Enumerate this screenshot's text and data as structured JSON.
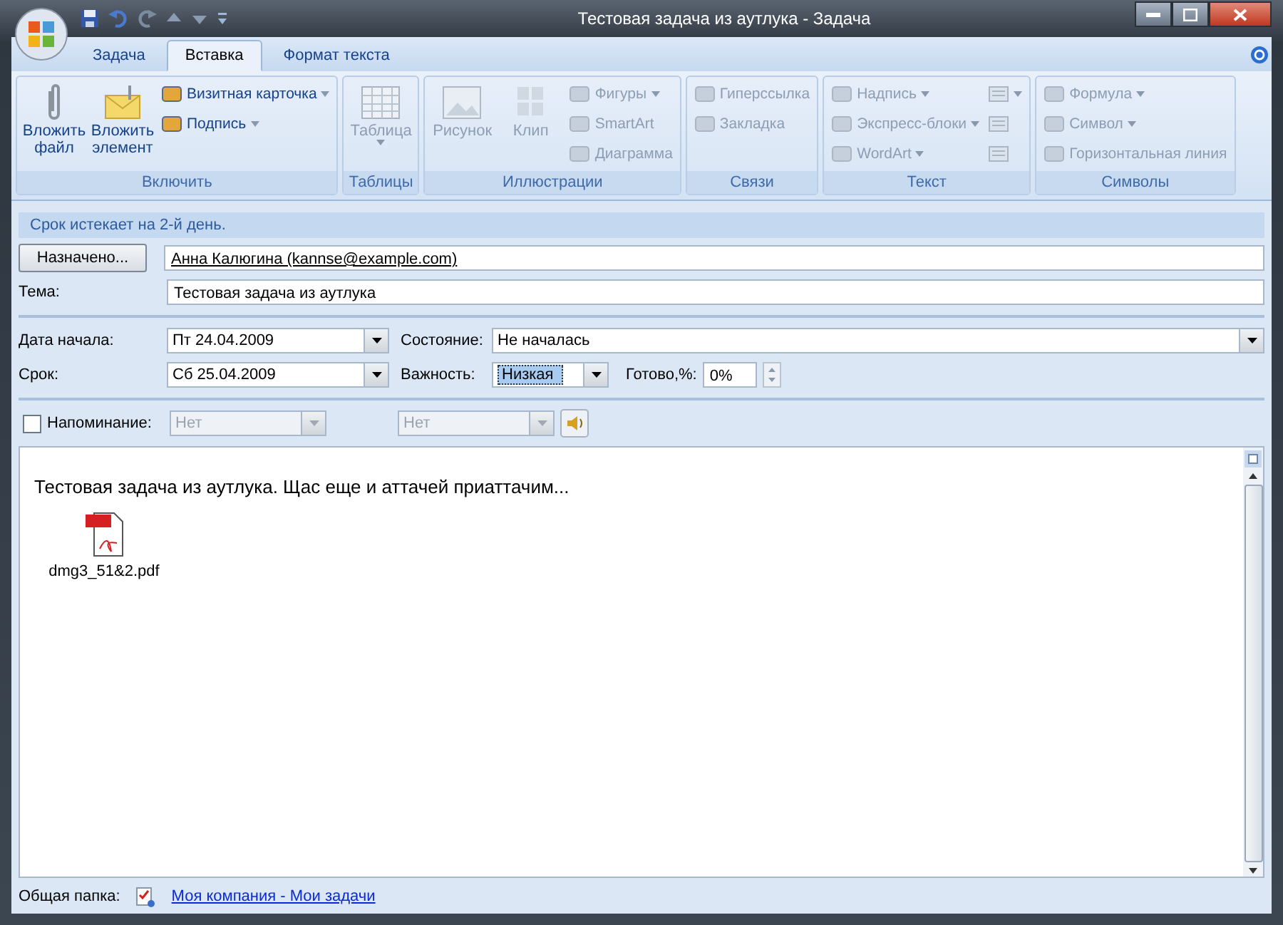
{
  "window": {
    "title": "Тестовая задача из аутлука - Задача"
  },
  "tabs": [
    {
      "label": "Задача",
      "selected": false
    },
    {
      "label": "Вставка",
      "selected": true
    },
    {
      "label": "Формат текста",
      "selected": false
    }
  ],
  "ribbon_groups": [
    {
      "label": "Включить",
      "columns": [
        {
          "kind": "large",
          "items": [
            {
              "label": "Вложить файл",
              "disabled": false,
              "menu": false
            }
          ]
        },
        {
          "kind": "large",
          "items": [
            {
              "label": "Вложить элемент",
              "disabled": false,
              "menu": false
            }
          ]
        },
        {
          "kind": "small",
          "items": [
            {
              "label": "Визитная карточка",
              "disabled": false,
              "menu": true
            },
            {
              "label": "Подпись",
              "disabled": false,
              "menu": true
            }
          ]
        }
      ]
    },
    {
      "label": "Таблицы",
      "columns": [
        {
          "kind": "large",
          "items": [
            {
              "label": "Таблица",
              "disabled": true,
              "menu": true
            }
          ]
        }
      ]
    },
    {
      "label": "Иллюстрации",
      "columns": [
        {
          "kind": "large",
          "items": [
            {
              "label": "Рисунок",
              "disabled": true,
              "menu": false
            }
          ]
        },
        {
          "kind": "large",
          "items": [
            {
              "label": "Клип",
              "disabled": true,
              "menu": false
            }
          ]
        },
        {
          "kind": "small",
          "items": [
            {
              "label": "Фигуры",
              "disabled": true,
              "menu": true
            },
            {
              "label": "SmartArt",
              "disabled": true,
              "menu": false
            },
            {
              "label": "Диаграмма",
              "disabled": true,
              "menu": false
            }
          ]
        }
      ]
    },
    {
      "label": "Связи",
      "columns": [
        {
          "kind": "small",
          "items": [
            {
              "label": "Гиперссылка",
              "disabled": true,
              "menu": false
            },
            {
              "label": "Закладка",
              "disabled": true,
              "menu": false
            }
          ]
        }
      ]
    },
    {
      "label": "Текст",
      "columns": [
        {
          "kind": "small",
          "items": [
            {
              "label": "Надпись",
              "disabled": true,
              "menu": true
            },
            {
              "label": "Экспресс-блоки",
              "disabled": true,
              "menu": true
            },
            {
              "label": "WordArt",
              "disabled": true,
              "menu": true
            }
          ]
        },
        {
          "kind": "icons",
          "items": [
            {
              "disabled": true,
              "menu": true
            },
            {
              "disabled": true,
              "menu": false
            },
            {
              "disabled": true,
              "menu": false
            }
          ]
        }
      ]
    },
    {
      "label": "Символы",
      "columns": [
        {
          "kind": "small",
          "items": [
            {
              "label": "Формула",
              "disabled": true,
              "menu": true
            },
            {
              "label": "Символ",
              "disabled": true,
              "menu": true
            },
            {
              "label": "Горизонтальная линия",
              "disabled": true,
              "menu": false
            }
          ]
        }
      ]
    }
  ],
  "notice": "Срок истекает на 2-й день.",
  "assigned": {
    "button": "Назначено...",
    "value": "Анна Калюгина (kannse@example.com)"
  },
  "subject": {
    "label": "Тема:",
    "value": "Тестовая задача из аутлука"
  },
  "start": {
    "label": "Дата начала:",
    "value": "Пт 24.04.2009"
  },
  "due": {
    "label": "Срок:",
    "value": "Сб 25.04.2009"
  },
  "status": {
    "label": "Состояние:",
    "value": "Не началась"
  },
  "priority": {
    "label": "Важность:",
    "value": "Низкая",
    "selected": true
  },
  "complete": {
    "label": "Готово,%:",
    "value": "0%"
  },
  "reminder": {
    "label": "Напоминание:",
    "checked": false,
    "disabled": true,
    "date": "Нет",
    "time": "Нет"
  },
  "body": {
    "text": "Тестовая задача из аутлука. Щас еще и аттачей приаттачим...",
    "attachment": "dmg3_51&2.pdf"
  },
  "footer": {
    "label": "Общая папка:",
    "link": "Моя компания - Мои задачи"
  }
}
